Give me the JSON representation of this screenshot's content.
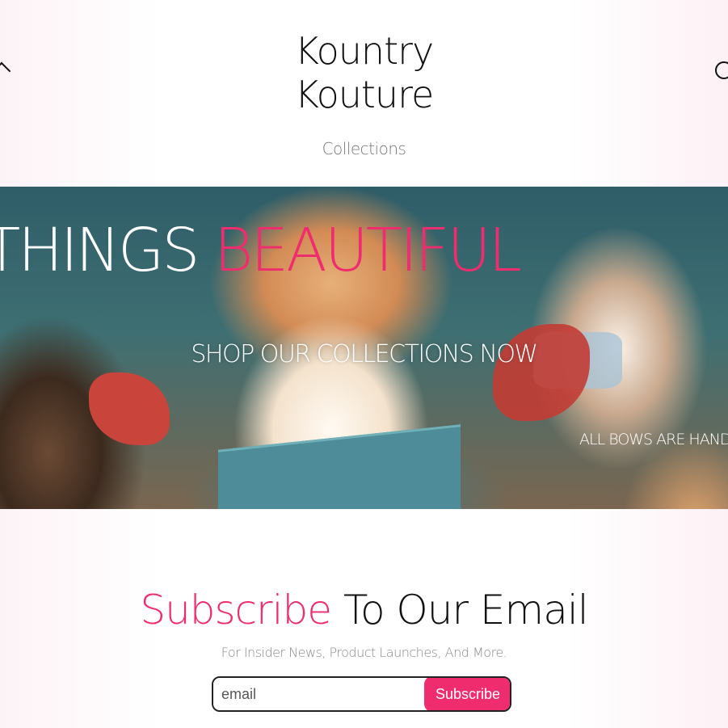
{
  "header": {
    "brand_line1": "Kountry",
    "brand_line2": "Kouture",
    "nav_link": "Collections",
    "left_icon": "chevron-left-icon",
    "right_icon": "account-icon"
  },
  "hero": {
    "tagline_part1": "THINGS",
    "tagline_part2": "BEAUTIFUL",
    "cta": "SHOP OUR COLLECTIONS NOW",
    "note": "ALL BOWS ARE HANDI",
    "accent_color": "#ee2c6e"
  },
  "subscribe": {
    "heading_accent": "Subscribe",
    "heading_rest": "To Our Email",
    "subtext": "For Insider News, Product Launches, And More.",
    "email_placeholder": "email",
    "button_label": "Subscribe",
    "button_color": "#ee2c6e"
  }
}
